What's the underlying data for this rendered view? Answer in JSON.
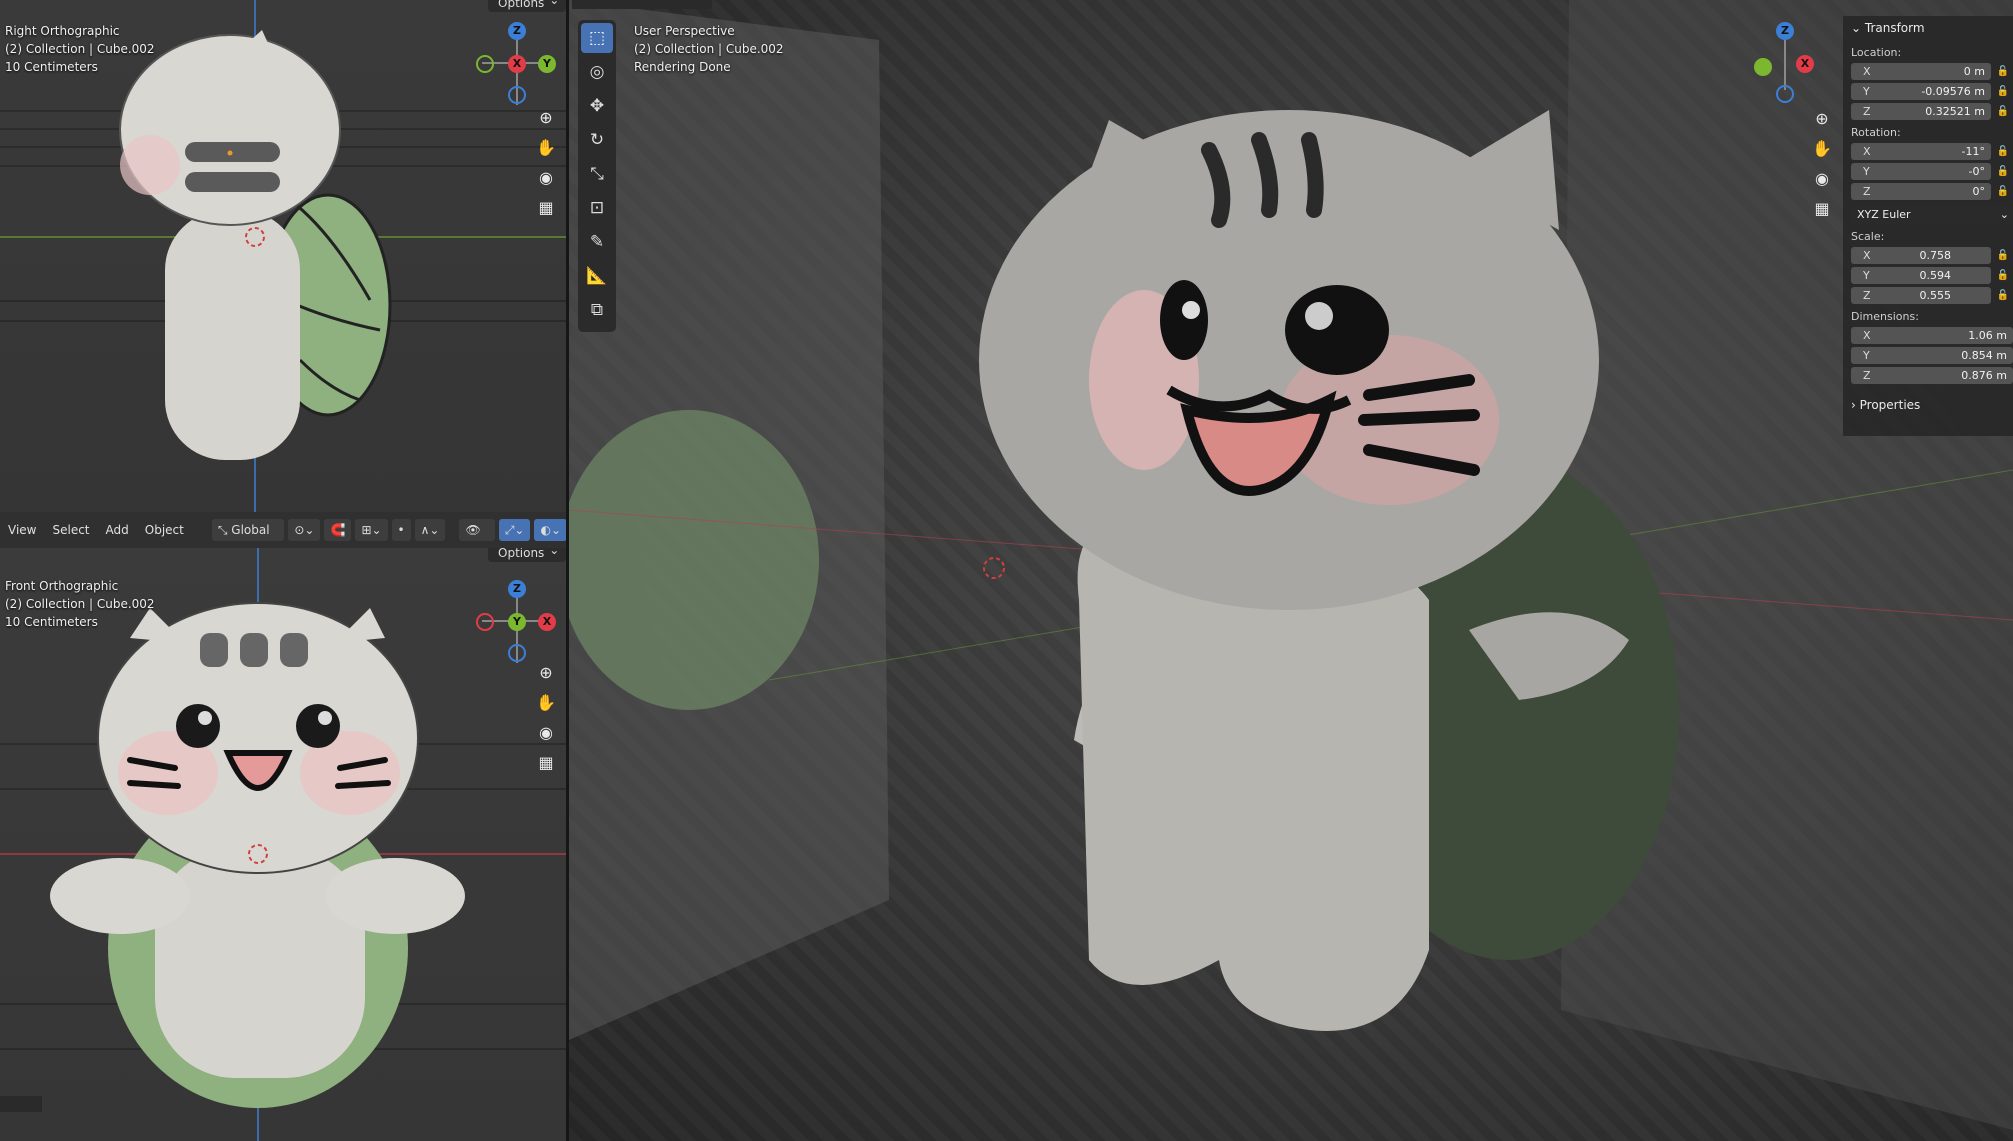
{
  "right_view": {
    "title": "Right Orthographic",
    "collection": "(2) Collection | Cube.002",
    "scale": "10 Centimeters",
    "options_label": "Options"
  },
  "front_view": {
    "title": "Front Orthographic",
    "collection": "(2) Collection | Cube.002",
    "scale": "10 Centimeters",
    "options_label": "Options"
  },
  "persp_view": {
    "title": "User Perspective",
    "collection": "(2) Collection | Cube.002",
    "status": "Rendering Done"
  },
  "gizmo_labels": {
    "x": "X",
    "y": "Y",
    "z": "Z"
  },
  "header": {
    "menus": [
      "View",
      "Select",
      "Add",
      "Object"
    ],
    "orientation": "Global"
  },
  "n_panel": {
    "section": "Transform",
    "location_label": "Location:",
    "location": [
      {
        "axis": "X",
        "value": "0 m"
      },
      {
        "axis": "Y",
        "value": "-0.09576 m"
      },
      {
        "axis": "Z",
        "value": "0.32521 m"
      }
    ],
    "rotation_label": "Rotation:",
    "rotation": [
      {
        "axis": "X",
        "value": "-11°"
      },
      {
        "axis": "Y",
        "value": "-0°"
      },
      {
        "axis": "Z",
        "value": "0°"
      }
    ],
    "rotation_mode": "XYZ Euler",
    "scale_label": "Scale:",
    "scale": [
      {
        "axis": "X",
        "value": "0.758"
      },
      {
        "axis": "Y",
        "value": "0.594"
      },
      {
        "axis": "Z",
        "value": "0.555"
      }
    ],
    "dimensions_label": "Dimensions:",
    "dimensions": [
      {
        "axis": "X",
        "value": "1.06 m"
      },
      {
        "axis": "Y",
        "value": "0.854 m"
      },
      {
        "axis": "Z",
        "value": "0.876 m"
      }
    ],
    "properties_label": "Properties"
  },
  "colors": {
    "x_axis": "#e23c48",
    "y_axis": "#7cb82f",
    "z_axis": "#3c7fd6",
    "active_tool": "#4772b3",
    "cat_body": "#d9d7d2",
    "shell_green": "#8fb07f"
  }
}
